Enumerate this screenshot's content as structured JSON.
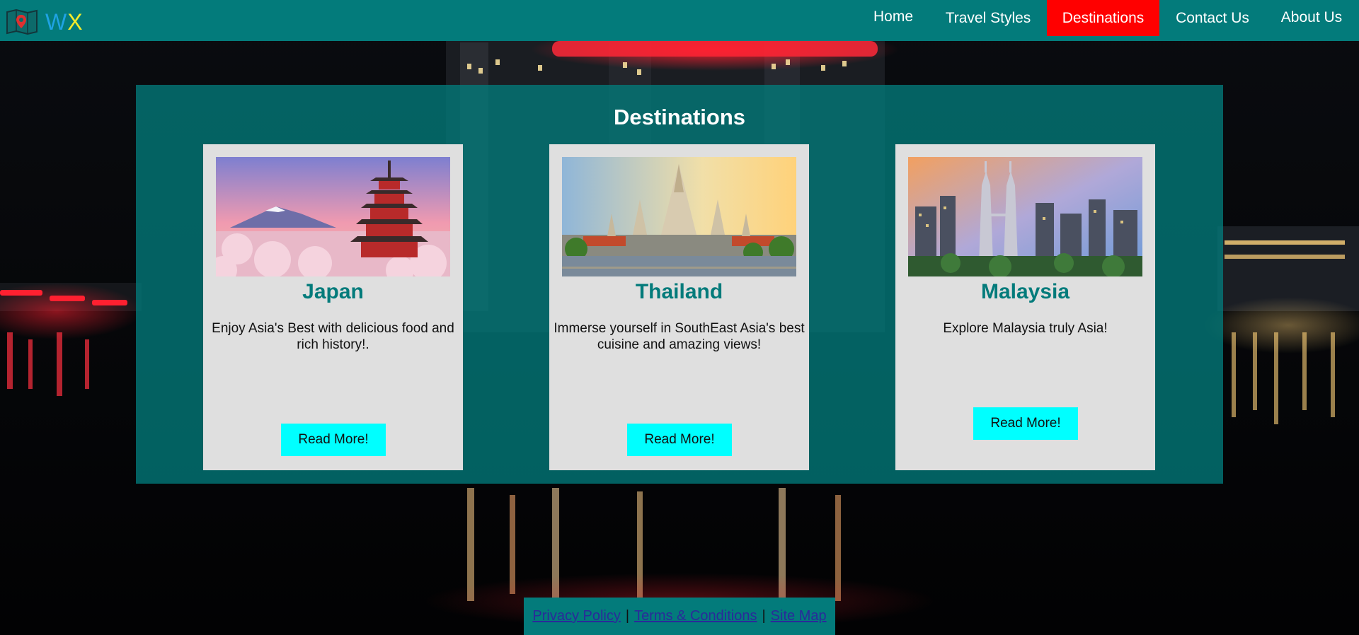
{
  "brand": {
    "logo_icon": "map-pin-icon",
    "letter_1": "W",
    "letter_2": "X",
    "colors": {
      "w": "#1fa3e3",
      "x": "#f4ec2a"
    }
  },
  "nav": {
    "items": [
      {
        "label": "Home",
        "active": false
      },
      {
        "label": "Travel Styles",
        "active": false
      },
      {
        "label": "Destinations",
        "active": true
      },
      {
        "label": "Contact Us",
        "active": false
      },
      {
        "label": "About Us",
        "active": false
      }
    ]
  },
  "colors": {
    "teal": "#037b7b",
    "active_nav": "#ff0000",
    "button": "#00ffff",
    "card_bg": "#dfdfdf"
  },
  "section": {
    "title": "Destinations",
    "cards": [
      {
        "title": "Japan",
        "image": "japan-pagoda-image",
        "description": "Enjoy Asia's Best with delicious food and rich history!.",
        "button": "Read More!"
      },
      {
        "title": "Thailand",
        "image": "thailand-temple-image",
        "description": "Immerse yourself in SouthEast Asia's best cuisine and amazing views!",
        "button": "Read More!"
      },
      {
        "title": "Malaysia",
        "image": "malaysia-skyline-image",
        "description": "Explore Malaysia truly Asia!",
        "button": "Read More!"
      }
    ]
  },
  "footer": {
    "links": [
      "Privacy Policy",
      "Terms & Conditions",
      "Site Map"
    ],
    "separator": "|"
  }
}
